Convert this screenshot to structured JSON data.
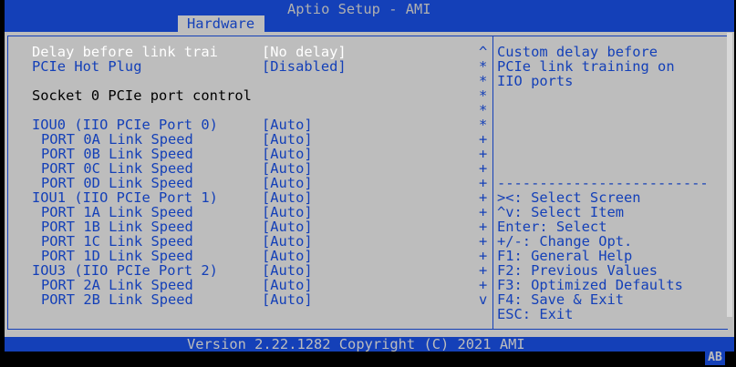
{
  "app_title": "Aptio Setup - AMI",
  "active_tab": "Hardware",
  "items": [
    {
      "label": "Delay before link trai",
      "value": "[No delay]",
      "selected": true
    },
    {
      "label": "PCIe Hot Plug",
      "value": "[Disabled]"
    },
    {
      "label": "Socket 0 PCIe port control",
      "value": ""
    },
    {
      "label": "IOU0 (IIO PCIe Port 0)",
      "value": "[Auto]"
    },
    {
      "label": "PORT 0A Link Speed",
      "value": "[Auto]"
    },
    {
      "label": "PORT 0B Link Speed",
      "value": "[Auto]"
    },
    {
      "label": "PORT 0C Link Speed",
      "value": "[Auto]"
    },
    {
      "label": "PORT 0D Link Speed",
      "value": "[Auto]"
    },
    {
      "label": "IOU1 (IIO PCIe Port 1)",
      "value": "[Auto]"
    },
    {
      "label": "PORT 1A Link Speed",
      "value": "[Auto]"
    },
    {
      "label": "PORT 1B Link Speed",
      "value": "[Auto]"
    },
    {
      "label": "PORT 1C Link Speed",
      "value": "[Auto]"
    },
    {
      "label": "PORT 1D Link Speed",
      "value": "[Auto]"
    },
    {
      "label": "IOU3 (IIO PCIe Port 2)",
      "value": "[Auto]"
    },
    {
      "label": "PORT 2A Link Speed",
      "value": "[Auto]"
    },
    {
      "label": "PORT 2B Link Speed",
      "value": "[Auto]"
    }
  ],
  "scroll_markers": [
    "^",
    "*",
    "*",
    "*",
    "*",
    "*",
    "+",
    "+",
    "+",
    "+",
    "+",
    "+",
    "+",
    "+",
    "+",
    "+",
    "+",
    "v"
  ],
  "help_text": [
    "Custom delay before",
    "PCIe link training on",
    "IIO ports"
  ],
  "help_separator": "-------------------------",
  "key_help": [
    "><: Select Screen",
    "^v: Select Item",
    "Enter: Select",
    "+/-: Change Opt.",
    "F1: General Help",
    "F2: Previous Values",
    "F3: Optimized Defaults",
    "F4: Save & Exit",
    "ESC: Exit"
  ],
  "footer": "Version 2.22.1282 Copyright (C) 2021 AMI",
  "corner_badge": "AB",
  "colors": {
    "bios_blue": "#1440b8",
    "panel_gray": "#bdbdbd"
  }
}
